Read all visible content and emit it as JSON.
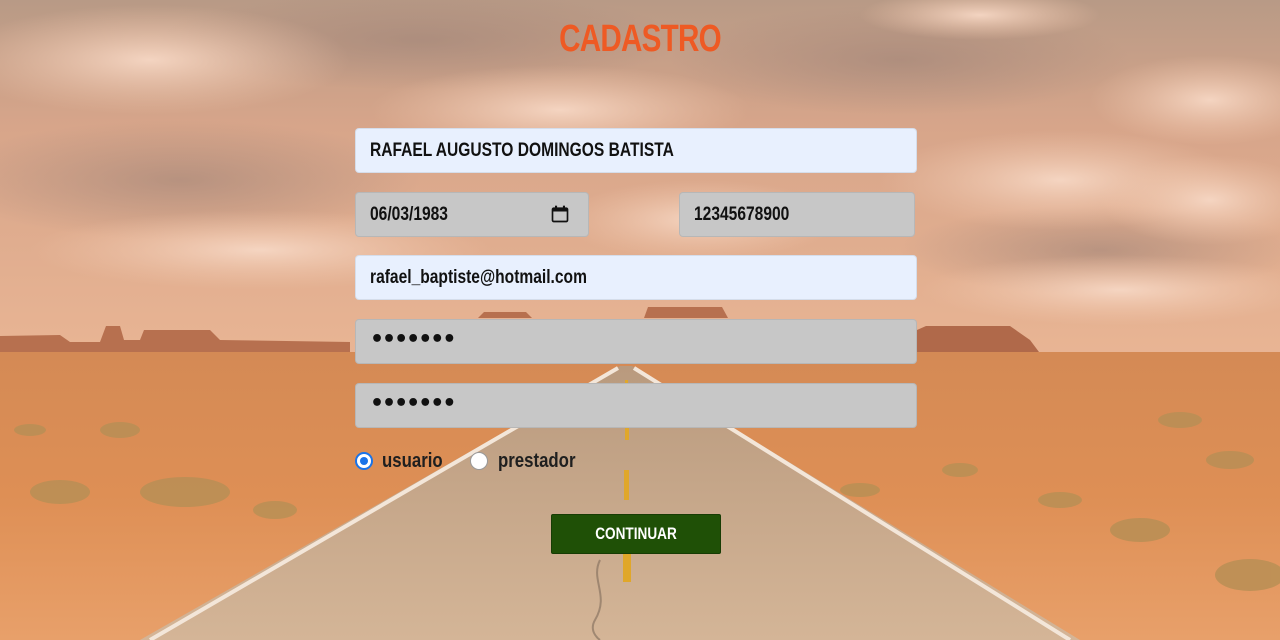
{
  "page": {
    "title": "CADASTRO"
  },
  "form": {
    "name_value": "RAFAEL AUGUSTO DOMINGOS BATISTA",
    "birthdate_value": "06/03/1983",
    "cpf_value": "12345678900",
    "email_value": "rafael_baptiste@hotmail.com",
    "password_mask": "•••••••",
    "confirm_password_mask": "•••••••",
    "user_type": {
      "options": [
        {
          "label": "usuario",
          "checked": true
        },
        {
          "label": "prestador",
          "checked": false
        }
      ]
    },
    "submit_label": "CONTINUAR"
  },
  "colors": {
    "title": "#ee5a24",
    "autofill_field_bg": "#e8f0fe",
    "field_bg": "#c7c7c7",
    "button_bg": "#1f5006",
    "radio_accent": "#1a73e8"
  },
  "icons": {
    "date_picker": "calendar-icon"
  }
}
